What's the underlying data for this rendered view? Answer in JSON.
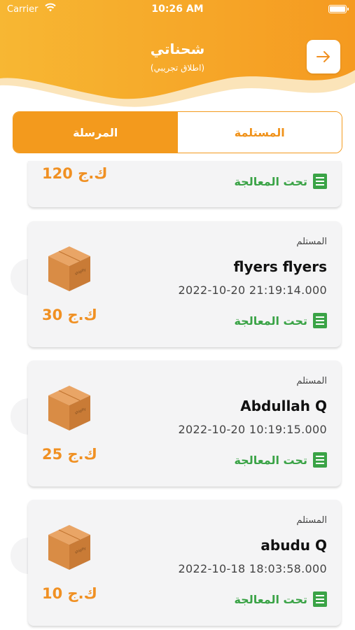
{
  "status_bar": {
    "carrier": "Carrier",
    "time": "10:26 AM"
  },
  "header": {
    "title": "شحناتي",
    "subtitle": "(اطلاق تجريبي)",
    "back_icon": "arrow-right-icon"
  },
  "tabs": [
    {
      "label": "المستلمة",
      "active": false
    },
    {
      "label": "المرسلة",
      "active": true
    }
  ],
  "colors": {
    "accent": "#f39a1d",
    "status_green": "#3aa346",
    "card_bg": "#f4f4f5"
  },
  "partial_card": {
    "weight": "120 ك.ج",
    "status": "تحت المعالجة"
  },
  "shipments": [
    {
      "label": "المستلم",
      "name": "flyers  flyers",
      "date": "2022-10-20 21:19:14.000",
      "status": "تحت المعالجة",
      "weight": "30 ك.ج",
      "box_icon": "package-box-icon"
    },
    {
      "label": "المستلم",
      "name": "Abdullah Q",
      "date": "2022-10-20 10:19:15.000",
      "status": "تحت المعالجة",
      "weight": "25 ك.ج",
      "box_icon": "package-box-icon"
    },
    {
      "label": "المستلم",
      "name": "abudu Q",
      "date": "2022-10-18 18:03:58.000",
      "status": "تحت المعالجة",
      "weight": "10 ك.ج",
      "box_icon": "package-box-icon"
    }
  ]
}
